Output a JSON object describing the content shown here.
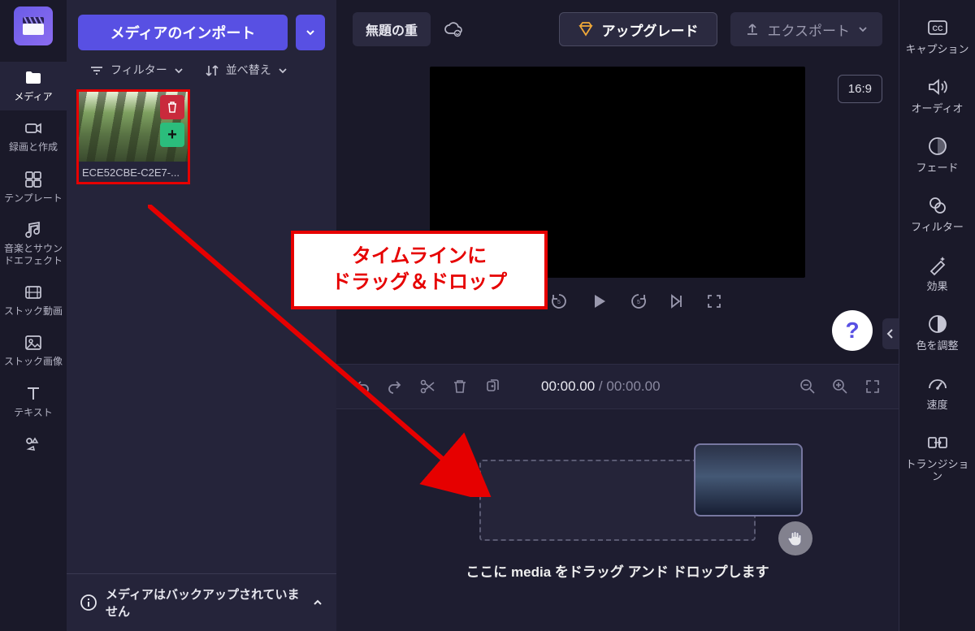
{
  "left_nav": {
    "items": [
      {
        "label": "メディア",
        "icon": "folder-icon"
      },
      {
        "label": "録画と作成",
        "icon": "camera-icon"
      },
      {
        "label": "テンプレート",
        "icon": "template-icon"
      },
      {
        "label": "音楽とサウンドエフェクト",
        "icon": "music-icon"
      },
      {
        "label": "ストック動画",
        "icon": "film-icon"
      },
      {
        "label": "ストック画像",
        "icon": "image-icon"
      },
      {
        "label": "テキスト",
        "icon": "text-icon"
      },
      {
        "label": "",
        "icon": "brand-kit-icon"
      }
    ]
  },
  "media_panel": {
    "import_label": "メディアのインポート",
    "filter_label": "フィルター",
    "sort_label": "並べ替え",
    "clip_name": "ECE52CBE-C2E7-...",
    "backup_notice": "メディアはバックアップされていません"
  },
  "topbar": {
    "title": "無題の重",
    "upgrade": "アップグレード",
    "export": "エクスポート"
  },
  "preview": {
    "aspect": "16:9"
  },
  "timeline": {
    "current": "00:00.00",
    "total": "00:00.00",
    "drop_hint": "ここに media をドラッグ アンド ドロップします"
  },
  "right_nav": {
    "items": [
      {
        "label": "キャプション",
        "icon": "cc-icon"
      },
      {
        "label": "オーディオ",
        "icon": "speaker-icon"
      },
      {
        "label": "フェード",
        "icon": "fade-icon"
      },
      {
        "label": "フィルター",
        "icon": "filters-icon"
      },
      {
        "label": "効果",
        "icon": "fx-icon"
      },
      {
        "label": "色を調整",
        "icon": "color-adjust-icon"
      },
      {
        "label": "速度",
        "icon": "speed-icon"
      },
      {
        "label": "トランジション",
        "icon": "transition-icon"
      }
    ]
  },
  "annotation": {
    "line1": "タイムラインに",
    "line2": "ドラッグ＆ドロップ"
  }
}
